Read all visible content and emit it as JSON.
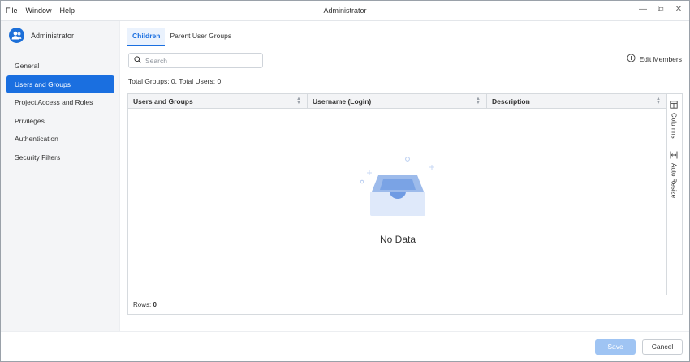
{
  "menu": {
    "file": "File",
    "window": "Window",
    "help": "Help"
  },
  "window": {
    "title": "Administrator"
  },
  "sidebar": {
    "user_name": "Administrator",
    "items": [
      {
        "label": "General"
      },
      {
        "label": "Users and Groups",
        "active": true
      },
      {
        "label": "Project Access and Roles"
      },
      {
        "label": "Privileges"
      },
      {
        "label": "Authentication"
      },
      {
        "label": "Security Filters"
      }
    ]
  },
  "tabs": [
    {
      "label": "Children",
      "active": true
    },
    {
      "label": "Parent User Groups"
    }
  ],
  "search": {
    "placeholder": "Search",
    "value": ""
  },
  "edit_members_label": "Edit Members",
  "totals": "Total Groups: 0, Total Users: 0",
  "grid": {
    "columns": [
      "Users and Groups",
      "Username (Login)",
      "Description"
    ],
    "side": {
      "columns_label": "Columns",
      "auto_resize_label": "Auto Resize"
    },
    "empty_text": "No Data",
    "rows_label": "Rows:",
    "rows_count": "0"
  },
  "footer": {
    "save_label": "Save",
    "cancel_label": "Cancel"
  },
  "colors": {
    "accent": "#1a6fe0",
    "save_disabled": "#9fc4f3"
  },
  "icons": [
    "users-icon",
    "search-icon",
    "plus-circle-icon",
    "sort-icon",
    "columns-icon",
    "auto-resize-icon",
    "empty-box-icon",
    "minimize-icon",
    "restore-icon",
    "close-icon"
  ]
}
